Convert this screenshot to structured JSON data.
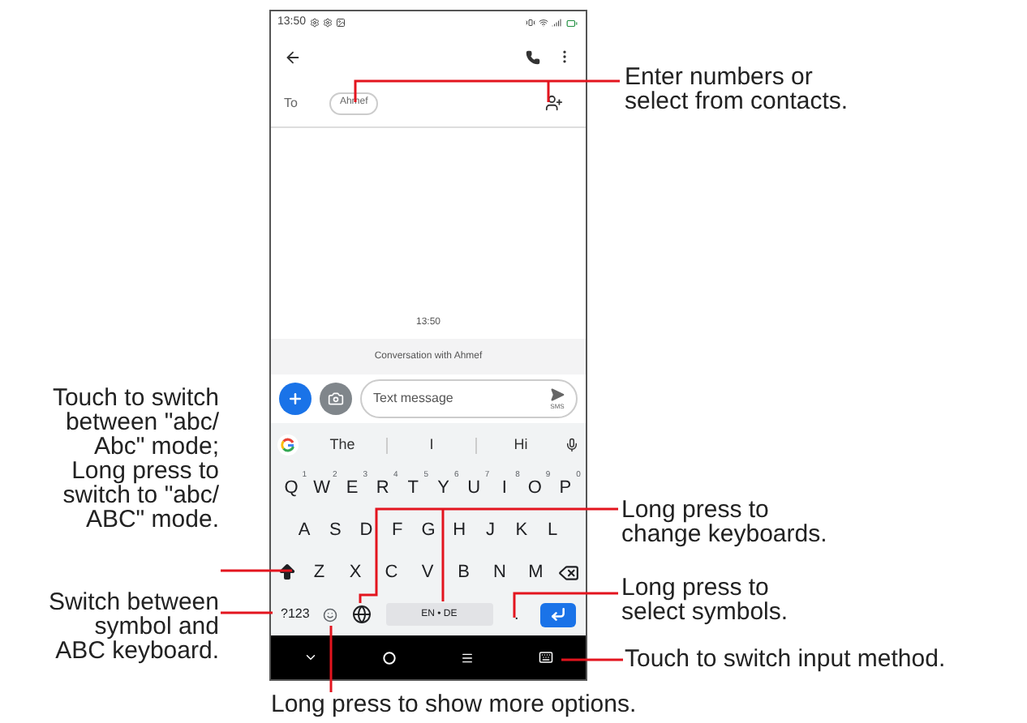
{
  "status_bar": {
    "time": "13:50"
  },
  "recipient": {
    "label": "To",
    "chip": "Ahmef"
  },
  "thread": {
    "timestamp": "13:50",
    "banner": "Conversation with Ahmef"
  },
  "compose": {
    "placeholder": "Text message",
    "send_label": "SMS"
  },
  "suggestions": [
    "The",
    "I",
    "Hi"
  ],
  "keyboard": {
    "rows": [
      [
        {
          "kind": "letter",
          "label": "Q",
          "hint": "1"
        },
        {
          "kind": "letter",
          "label": "W",
          "hint": "2"
        },
        {
          "kind": "letter",
          "label": "E",
          "hint": "3"
        },
        {
          "kind": "letter",
          "label": "R",
          "hint": "4"
        },
        {
          "kind": "letter",
          "label": "T",
          "hint": "5"
        },
        {
          "kind": "letter",
          "label": "Y",
          "hint": "6"
        },
        {
          "kind": "letter",
          "label": "U",
          "hint": "7"
        },
        {
          "kind": "letter",
          "label": "I",
          "hint": "8"
        },
        {
          "kind": "letter",
          "label": "O",
          "hint": "9"
        },
        {
          "kind": "letter",
          "label": "P",
          "hint": "0"
        }
      ],
      [
        {
          "kind": "letter",
          "label": "A"
        },
        {
          "kind": "letter",
          "label": "S"
        },
        {
          "kind": "letter",
          "label": "D"
        },
        {
          "kind": "letter",
          "label": "F"
        },
        {
          "kind": "letter",
          "label": "G"
        },
        {
          "kind": "letter",
          "label": "H"
        },
        {
          "kind": "letter",
          "label": "J"
        },
        {
          "kind": "letter",
          "label": "K"
        },
        {
          "kind": "letter",
          "label": "L"
        }
      ],
      [
        {
          "kind": "shift"
        },
        {
          "kind": "letter",
          "label": "Z"
        },
        {
          "kind": "letter",
          "label": "X"
        },
        {
          "kind": "letter",
          "label": "C"
        },
        {
          "kind": "letter",
          "label": "V"
        },
        {
          "kind": "letter",
          "label": "B"
        },
        {
          "kind": "letter",
          "label": "N"
        },
        {
          "kind": "letter",
          "label": "M"
        },
        {
          "kind": "backspace"
        }
      ]
    ],
    "bottom_row": [
      {
        "kind": "symbols",
        "label": "?123"
      },
      {
        "kind": "emoji"
      },
      {
        "kind": "globe"
      },
      {
        "kind": "space",
        "label": "EN • DE"
      },
      {
        "kind": "period",
        "label": "."
      },
      {
        "kind": "enter"
      }
    ]
  },
  "annotations": [
    {
      "lines": [
        "Enter numbers or",
        "select from contacts."
      ]
    },
    {
      "lines": [
        "Touch to switch",
        "between \"abc/",
        "Abc\" mode;",
        "Long press to",
        "switch to \"abc/",
        "ABC\" mode."
      ]
    },
    {
      "lines": [
        "Switch between",
        "symbol and",
        "ABC keyboard."
      ]
    },
    {
      "lines": [
        "Long press to",
        "change keyboards."
      ]
    },
    {
      "lines": [
        "Long press to",
        "select symbols."
      ]
    },
    {
      "lines": [
        "Touch to switch input method."
      ]
    },
    {
      "lines": [
        "Long press to show more options."
      ]
    }
  ]
}
